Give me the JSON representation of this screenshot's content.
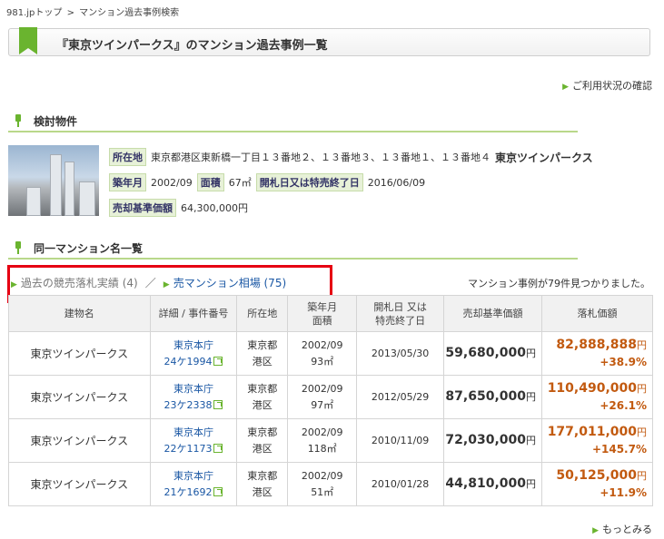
{
  "breadcrumb": {
    "home": "981.jpトップ",
    "sep": ">",
    "current": "マンション過去事例検索"
  },
  "title": "『東京ツインパークス』のマンション過去事例一覧",
  "usage_link": "ご利用状況の確認",
  "section_property": "検討物件",
  "property": {
    "location_label": "所在地",
    "location": "東京都港区東新橋一丁目１３番地２、１３番地３、１３番地１、１３番地４",
    "name": "東京ツインパークス",
    "built_label": "築年月",
    "built": "2002/09",
    "area_label": "面積",
    "area": "67㎡",
    "date_label": "開札日又は特売終了日",
    "date": "2016/06/09",
    "price_label": "売却基準価額",
    "price": "64,300,000円"
  },
  "section_same": "同一マンション名一覧",
  "tabs": {
    "past": "過去の競売落札実績 (4)",
    "sep": "／",
    "market": "売マンション相場 (75)"
  },
  "count_text": "マンション事例が79件見つかりました。",
  "table": {
    "headers": {
      "name": "建物名",
      "detail": "詳細 / 事件番号",
      "loc": "所在地",
      "built1": "築年月",
      "built2": "面積",
      "date1": "開札日 又は",
      "date2": "特売終了日",
      "base": "売却基準価額",
      "bid": "落札価額"
    },
    "rows": [
      {
        "name": "東京ツインパークス",
        "court": "東京本庁",
        "case": "24ケ1994",
        "loc1": "東京都",
        "loc2": "港区",
        "built": "2002/09",
        "area": "93㎡",
        "date": "2013/05/30",
        "base": "59,680,000",
        "unit": "円",
        "bid": "82,888,888",
        "ratio": "+38.9%"
      },
      {
        "name": "東京ツインパークス",
        "court": "東京本庁",
        "case": "23ケ2338",
        "loc1": "東京都",
        "loc2": "港区",
        "built": "2002/09",
        "area": "97㎡",
        "date": "2012/05/29",
        "base": "87,650,000",
        "unit": "円",
        "bid": "110,490,000",
        "ratio": "+26.1%"
      },
      {
        "name": "東京ツインパークス",
        "court": "東京本庁",
        "case": "22ケ1173",
        "loc1": "東京都",
        "loc2": "港区",
        "built": "2002/09",
        "area": "118㎡",
        "date": "2010/11/09",
        "base": "72,030,000",
        "unit": "円",
        "bid": "177,011,000",
        "ratio": "+145.7%"
      },
      {
        "name": "東京ツインパークス",
        "court": "東京本庁",
        "case": "21ケ1692",
        "loc1": "東京都",
        "loc2": "港区",
        "built": "2002/09",
        "area": "51㎡",
        "date": "2010/01/28",
        "base": "44,810,000",
        "unit": "円",
        "bid": "50,125,000",
        "ratio": "+11.9%"
      }
    ]
  },
  "more_link": "もっとみる",
  "colors": {
    "accent_green": "#6ab42f",
    "link_blue": "#1a57a4",
    "bid_orange": "#c25a10",
    "highlight_red": "#e60012"
  }
}
